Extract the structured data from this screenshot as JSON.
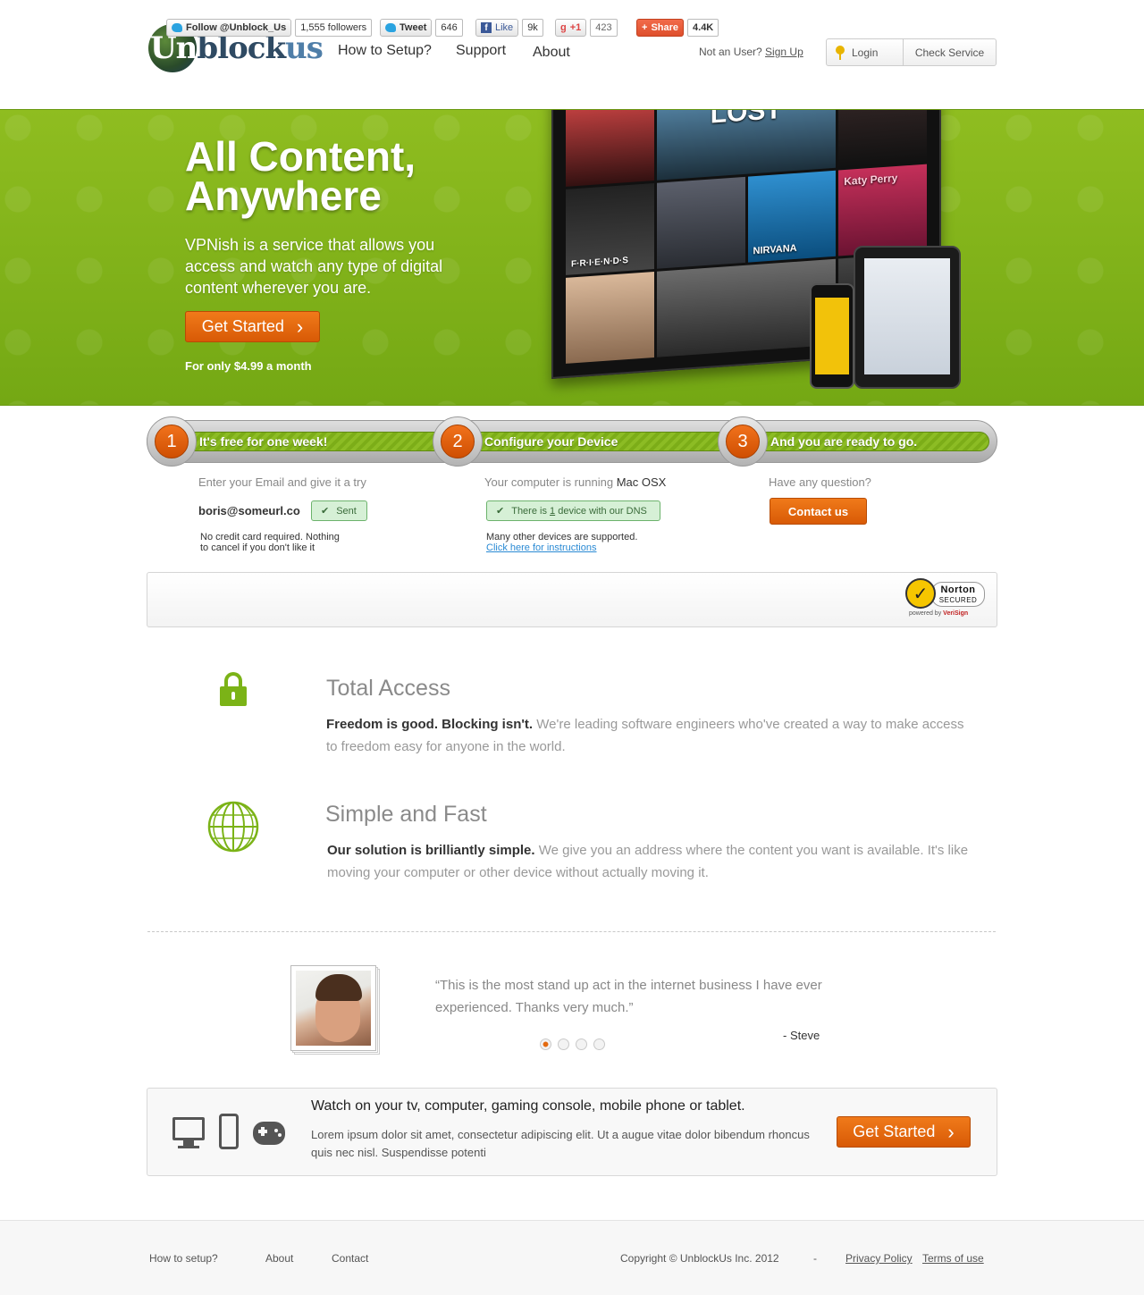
{
  "header": {
    "logo": {
      "un": "Un",
      "block": "block",
      "us": "us"
    },
    "nav": [
      "How to Setup?",
      "Support",
      "About"
    ],
    "not_user_text": "Not an User?",
    "sign_up": "Sign Up",
    "login": "Login",
    "check_service": "Check Service"
  },
  "hero": {
    "title_line1": "All Content,",
    "title_line2": "Anywhere",
    "subtitle": "VPNish is a service that allows you access and watch any type of digital content wherever you are.",
    "cta": "Get Started",
    "cta_arrow": "›",
    "price": "For only $4.99 a month",
    "tiles": [
      "LOST",
      "Katy Perry",
      "F·R·I·E·N·D·S",
      "NIRVANA"
    ],
    "colors": {
      "green_top": "#8fbd20",
      "green_bottom": "#74a814"
    }
  },
  "steps": [
    {
      "num": "1",
      "label": "It's free for one week!"
    },
    {
      "num": "2",
      "label": "Configure your Device"
    },
    {
      "num": "3",
      "label": "And you are ready to go."
    }
  ],
  "step1": {
    "prompt": "Enter your Email and give it a try",
    "email": "boris@someurl.co",
    "status": "Sent",
    "check": "✔",
    "note": [
      "No credit card required. Nothing",
      "to cancel if you don't like it"
    ]
  },
  "step2": {
    "prompt": "Your computer is running",
    "os": "Mac OSX",
    "status_pre": "There is",
    "status_num": "1",
    "status_post": "device with our DNS",
    "check": "✔",
    "note": "Many other devices are supported.",
    "link": "Click here for instructions"
  },
  "step3": {
    "prompt": "Have any question?",
    "button": "Contact us"
  },
  "social": {
    "follow": "Follow @Unblock_Us",
    "followers": "1,555 followers",
    "tweet": "Tweet",
    "tweet_count": "646",
    "like": "Like",
    "like_count": "9k",
    "gplus": "+1",
    "gplus_g": "g",
    "gplus_count": "423",
    "share": "Share",
    "share_plus": "+",
    "share_count": "4.4K",
    "norton_name": "Norton",
    "norton_secured": "SECURED",
    "norton_powered": "powered by",
    "norton_verisign": "VeriSign",
    "norton_check": "✓"
  },
  "features": [
    {
      "title": "Total Access",
      "bold": "Freedom is good. Blocking isn't.",
      "text": " We're leading software engineers who've created a way to make access to freedom easy for anyone in the world.",
      "icon": "lock-icon"
    },
    {
      "title": "Simple and Fast",
      "bold": "Our solution is brilliantly simple.",
      "text": " We give you an address where the content you want is available. It's like moving your computer or other device without actually moving it.",
      "icon": "globe-icon"
    }
  ],
  "testimonial": {
    "quote": "“This is the most stand up act in the internet business I have ever experienced. Thanks very much.”",
    "author": "- Steve",
    "active_dot": 0,
    "dot_count": 4
  },
  "cta": {
    "title": "Watch on your tv, computer, gaming console, mobile phone or tablet.",
    "text": "Lorem ipsum dolor sit amet, consectetur adipiscing elit. Ut a augue vitae dolor bibendum rhoncus quis nec nisl. Suspendisse potenti",
    "button": "Get Started",
    "arrow": "›"
  },
  "footer": {
    "links": [
      "How to setup?",
      "About",
      "Contact"
    ],
    "copyright": "Copyright © UnblockUs Inc. 2012",
    "separator": "-",
    "privacy": "Privacy Policy",
    "terms": "Terms of use"
  }
}
